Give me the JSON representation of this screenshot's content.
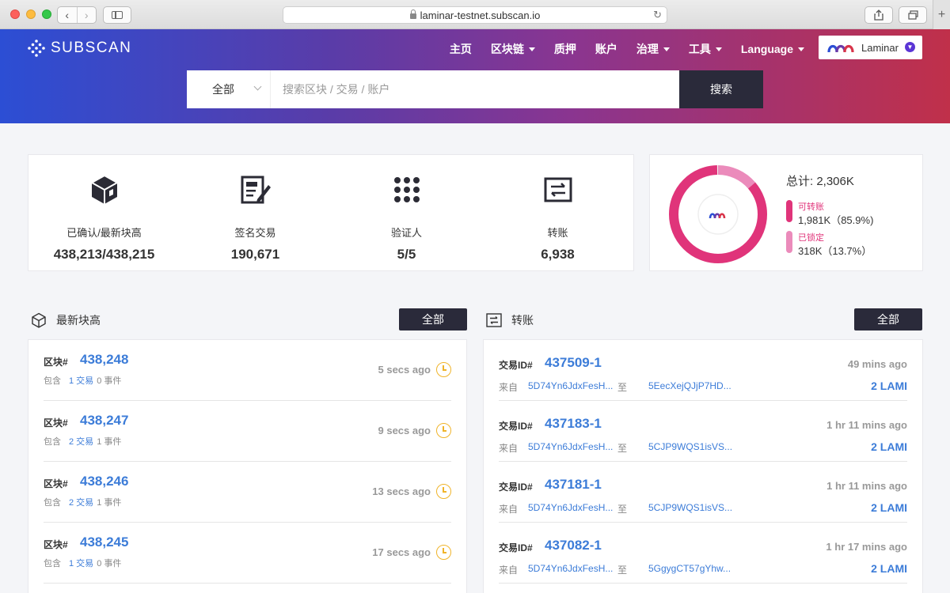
{
  "browser": {
    "url": "laminar-testnet.subscan.io"
  },
  "header": {
    "logo_text": "SUBSCAN",
    "nav": [
      {
        "label": "主页",
        "dropdown": false
      },
      {
        "label": "区块链",
        "dropdown": true
      },
      {
        "label": "质押",
        "dropdown": false
      },
      {
        "label": "账户",
        "dropdown": false
      },
      {
        "label": "治理",
        "dropdown": true
      },
      {
        "label": "工具",
        "dropdown": true
      },
      {
        "label": "Language",
        "dropdown": true
      }
    ],
    "network": "Laminar"
  },
  "search": {
    "type": "全部",
    "placeholder": "搜索区块 / 交易 / 账户",
    "button": "搜索"
  },
  "stats": [
    {
      "icon": "block-icon",
      "label": "已确认/最新块高",
      "value": "438,213/438,215"
    },
    {
      "icon": "signed-extrinsics-icon",
      "label": "签名交易",
      "value": "190,671"
    },
    {
      "icon": "validators-icon",
      "label": "验证人",
      "value": "5/5"
    },
    {
      "icon": "transfer-icon",
      "label": "转账",
      "value": "6,938"
    }
  ],
  "supply": {
    "total": "总计: 2,306K",
    "transferable_label": "可转账",
    "transferable_value": "1,981K（85.9%)",
    "transferable_pct": 85.9,
    "locked_label": "已锁定",
    "locked_value": "318K（13.7%）",
    "locked_pct": 13.7,
    "colors": {
      "transferable": "#e0347a",
      "locked": "#eb8bbb"
    }
  },
  "blocks_panel": {
    "title": "最新块高",
    "all_button": "全部",
    "rows": [
      {
        "key": "区块#",
        "number": "438,248",
        "contains": "包含",
        "ext": "1 交易",
        "events": "0 事件",
        "time": "5 secs ago"
      },
      {
        "key": "区块#",
        "number": "438,247",
        "contains": "包含",
        "ext": "2 交易",
        "events": "1 事件",
        "time": "9 secs ago"
      },
      {
        "key": "区块#",
        "number": "438,246",
        "contains": "包含",
        "ext": "2 交易",
        "events": "1 事件",
        "time": "13 secs ago"
      },
      {
        "key": "区块#",
        "number": "438,245",
        "contains": "包含",
        "ext": "1 交易",
        "events": "0 事件",
        "time": "17 secs ago"
      }
    ]
  },
  "transfers_panel": {
    "title": "转账",
    "all_button": "全部",
    "rows": [
      {
        "key": "交易ID#",
        "id": "437509-1",
        "time": "49 mins ago",
        "from_label": "来自",
        "from": "5D74Yn6JdxFesH...",
        "to_label": "至",
        "to": "5EecXejQJjP7HD...",
        "amount": "2 LAMI"
      },
      {
        "key": "交易ID#",
        "id": "437183-1",
        "time": "1 hr 11 mins ago",
        "from_label": "来自",
        "from": "5D74Yn6JdxFesH...",
        "to_label": "至",
        "to": "5CJP9WQS1isVS...",
        "amount": "2 LAMI"
      },
      {
        "key": "交易ID#",
        "id": "437181-1",
        "time": "1 hr 11 mins ago",
        "from_label": "来自",
        "from": "5D74Yn6JdxFesH...",
        "to_label": "至",
        "to": "5CJP9WQS1isVS...",
        "amount": "2 LAMI"
      },
      {
        "key": "交易ID#",
        "id": "437082-1",
        "time": "1 hr 17 mins ago",
        "from_label": "来自",
        "from": "5D74Yn6JdxFesH...",
        "to_label": "至",
        "to": "5GgygCT57gYhw...",
        "amount": "2 LAMI"
      }
    ]
  }
}
